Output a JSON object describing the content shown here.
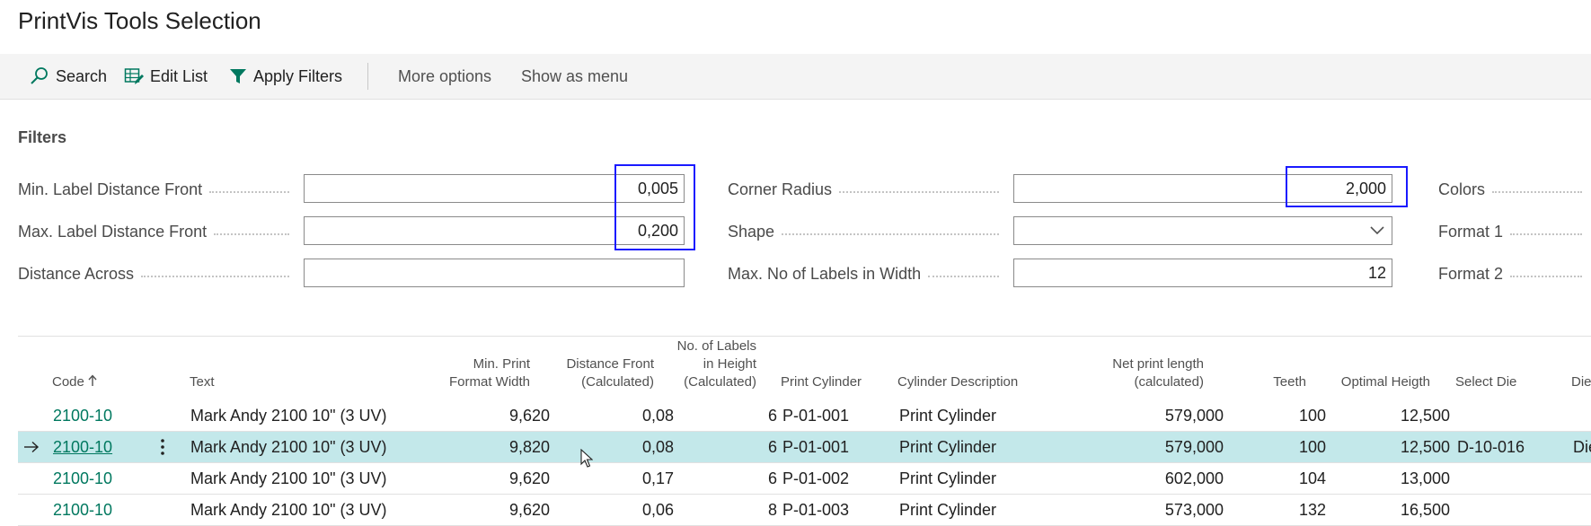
{
  "page": {
    "title": "PrintVis Tools Selection"
  },
  "toolbar": {
    "search": "Search",
    "edit_list": "Edit List",
    "apply_filters": "Apply Filters",
    "more_options": "More options",
    "show_as_menu": "Show as menu"
  },
  "filters": {
    "title": "Filters",
    "min_label_distance_front": {
      "label": "Min. Label Distance Front",
      "value": "0,005"
    },
    "max_label_distance_front": {
      "label": "Max. Label Distance Front",
      "value": "0,200"
    },
    "distance_across": {
      "label": "Distance Across",
      "value": ""
    },
    "corner_radius": {
      "label": "Corner Radius",
      "value": "2,000"
    },
    "shape": {
      "label": "Shape",
      "value": ""
    },
    "max_no_labels_width": {
      "label": "Max. No of Labels in Width",
      "value": "12"
    },
    "colors": {
      "label": "Colors"
    },
    "format1": {
      "label": "Format 1"
    },
    "format2": {
      "label": "Format 2"
    }
  },
  "table": {
    "headers": {
      "code": "Code",
      "text": "Text",
      "min_print_l1": "Min. Print",
      "min_print_l2": "Format Width",
      "dist_front_l1": "Distance Front",
      "dist_front_l2": "(Calculated)",
      "labels_h_l1": "No. of Labels",
      "labels_h_l2": "in Height",
      "labels_h_l3": "(Calculated)",
      "print_cylinder": "Print Cylinder",
      "cyl_desc": "Cylinder Description",
      "net_len_l1": "Net print length",
      "net_len_l2": "(calculated)",
      "teeth": "Teeth",
      "optimal_height": "Optimal Heigth",
      "select_die": "Select Die",
      "die": "Die"
    },
    "rows": [
      {
        "code": "2100-10",
        "text": "Mark Andy 2100 10\" (3 UV)",
        "min_print": "9,620",
        "dist_front": "0,08",
        "labels_h": "6",
        "cylinder": "P-01-001",
        "cyl_desc": "Print Cylinder",
        "net_len": "579,000",
        "teeth": "100",
        "opt_height": "12,500",
        "select_die": "",
        "die": ""
      },
      {
        "code": "2100-10",
        "text": "Mark Andy 2100 10\" (3 UV)",
        "min_print": "9,820",
        "dist_front": "0,08",
        "labels_h": "6",
        "cylinder": "P-01-001",
        "cyl_desc": "Print Cylinder",
        "net_len": "579,000",
        "teeth": "100",
        "opt_height": "12,500",
        "select_die": "D-10-016",
        "die": "Die"
      },
      {
        "code": "2100-10",
        "text": "Mark Andy 2100 10\" (3 UV)",
        "min_print": "9,620",
        "dist_front": "0,17",
        "labels_h": "6",
        "cylinder": "P-01-002",
        "cyl_desc": "Print Cylinder",
        "net_len": "602,000",
        "teeth": "104",
        "opt_height": "13,000",
        "select_die": "",
        "die": ""
      },
      {
        "code": "2100-10",
        "text": "Mark Andy 2100 10\" (3 UV)",
        "min_print": "9,620",
        "dist_front": "0,06",
        "labels_h": "8",
        "cylinder": "P-01-003",
        "cyl_desc": "Print Cylinder",
        "net_len": "573,000",
        "teeth": "132",
        "opt_height": "16,500",
        "select_die": "",
        "die": ""
      }
    ]
  }
}
